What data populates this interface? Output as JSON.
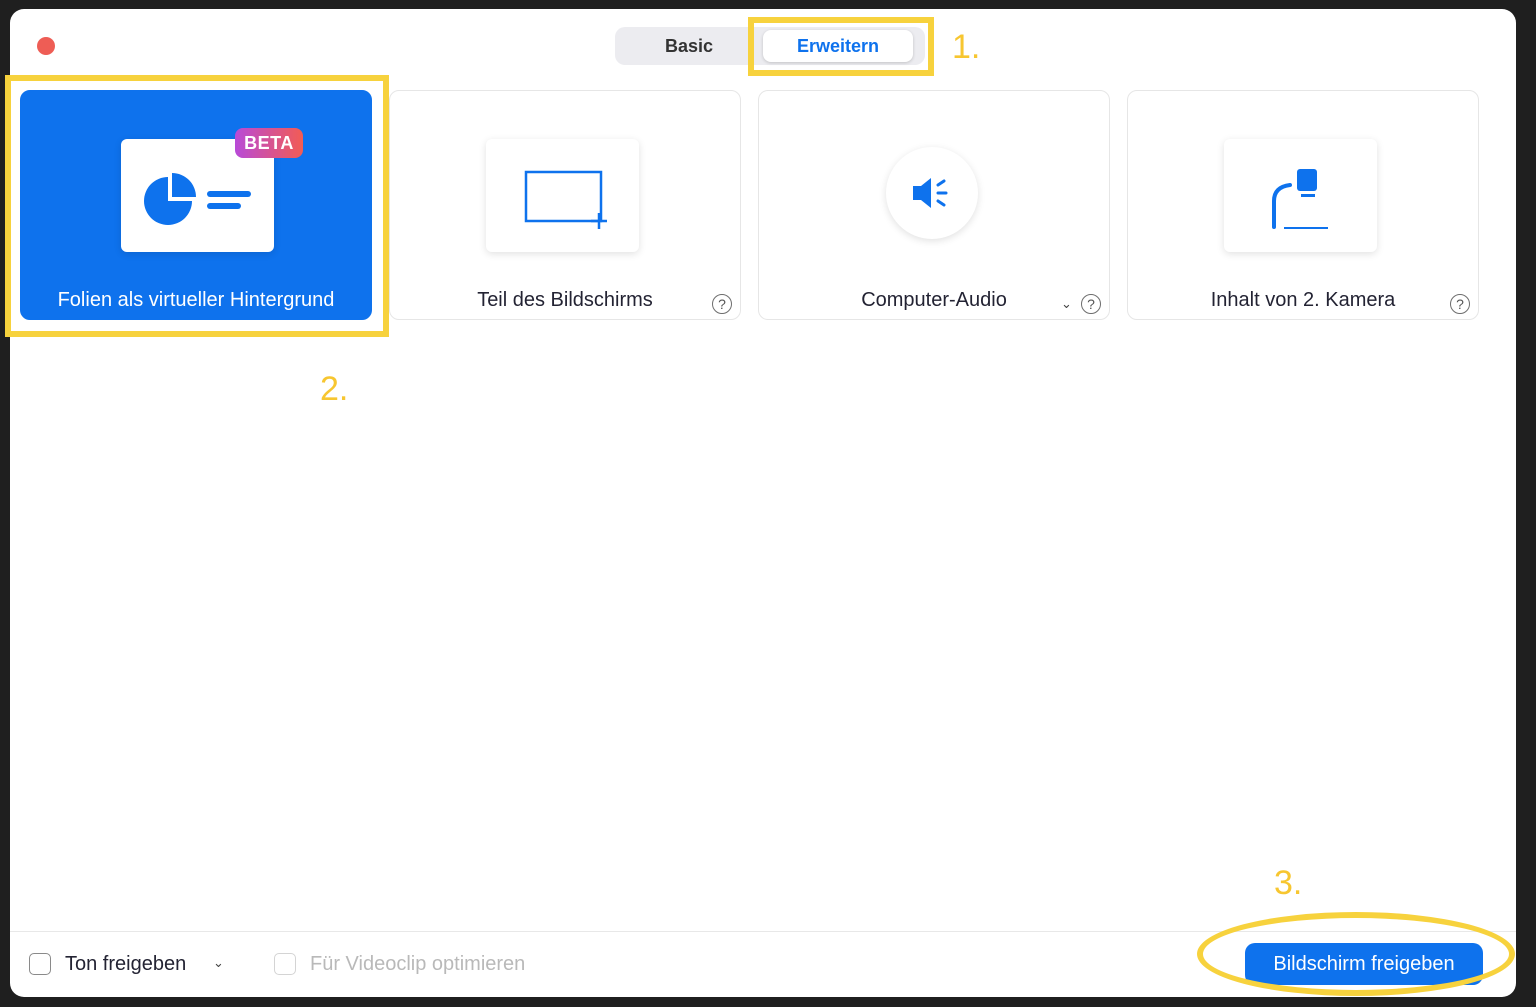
{
  "tabs": {
    "basic": "Basic",
    "advanced": "Erweitern"
  },
  "annotations": {
    "step1": "1.",
    "step2": "2.",
    "step3": "3."
  },
  "cards": {
    "slides": {
      "label": "Folien als virtueller Hintergrund",
      "badge": "BETA",
      "icon": "slides-background-icon"
    },
    "portion": {
      "label": "Teil des Bildschirms",
      "icon": "screen-portion-icon"
    },
    "audio": {
      "label": "Computer-Audio",
      "icon": "speaker-icon"
    },
    "camera": {
      "label": "Inhalt von 2. Kamera",
      "icon": "document-camera-icon"
    }
  },
  "help_glyph": "?",
  "dropdown_glyph": "⌄",
  "footer": {
    "share_sound": "Ton freigeben",
    "optimize_video": "Für Videoclip optimieren",
    "share_button": "Bildschirm freigeben"
  },
  "colors": {
    "accent": "#0e72ed",
    "annotation": "#f7d23d",
    "close": "#ee5d55"
  }
}
